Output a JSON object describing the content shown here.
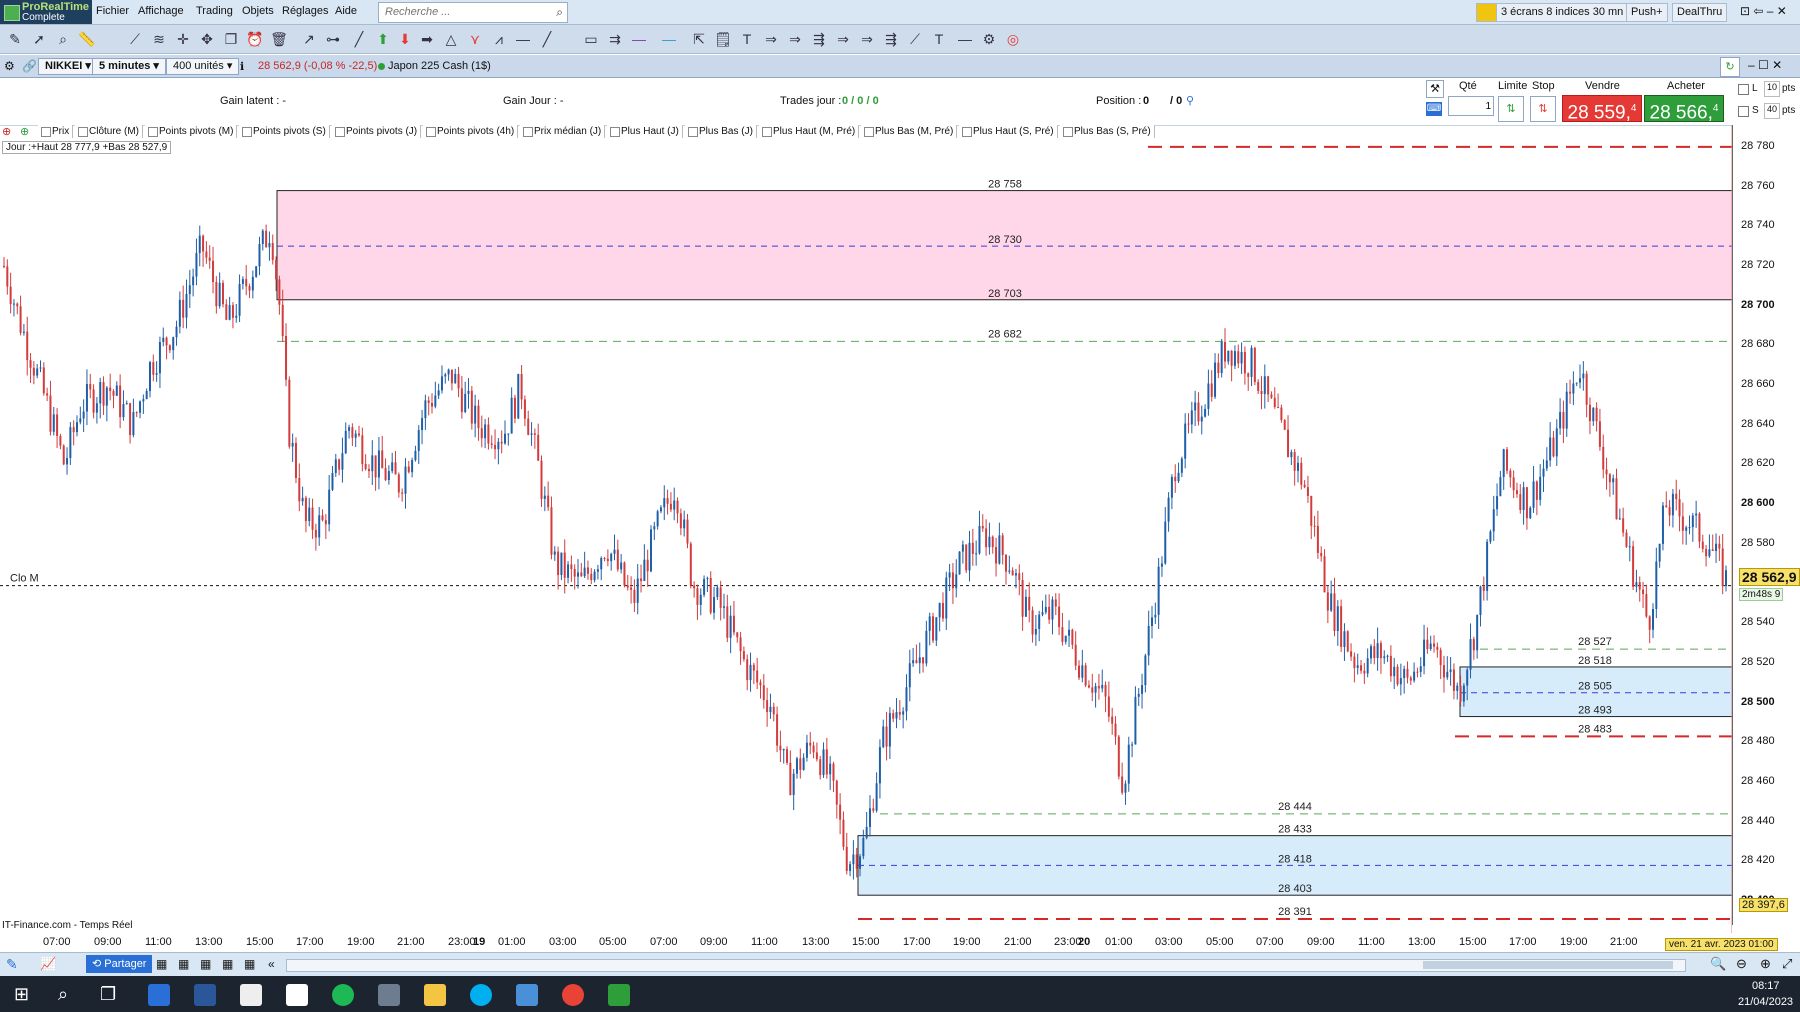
{
  "app": {
    "name_line1": "ProRealTime",
    "name_line2": "Complete"
  },
  "menu": [
    "Fichier",
    "Affichage",
    "Trading",
    "Objets",
    "Réglages",
    "Aide"
  ],
  "search": {
    "placeholder": "Recherche ..."
  },
  "top_right": {
    "layout": "3 écrans 8 indices 30 mn",
    "push": "Push+",
    "dealthru": "DealThru"
  },
  "chart_header": {
    "instrument": "NIKKEI",
    "timeframe": "5 minutes",
    "units": "400 unités",
    "quote": "28 562,9 (-0,08 % -22,5)",
    "market": "Japon 225 Cash (1$)"
  },
  "trading": {
    "gain_latent": "Gain latent : -",
    "gain_jour": "Gain Jour : -",
    "trades_jour_label": "Trades jour :",
    "trades_jour_value": "0 / 0 / 0",
    "position_label": "Position :",
    "position_value": "0",
    "position_extra": "/ 0",
    "qte_label": "Qté",
    "qte_value": "1",
    "limite_label": "Limite",
    "stop_label": "Stop",
    "vendre_label": "Vendre",
    "acheter_label": "Acheter",
    "sell_price": "28 559,",
    "sell_price_sup": "4",
    "buy_price": "28 566,",
    "buy_price_sup": "4",
    "l_label": "L",
    "l_value": "10",
    "s_label": "S",
    "s_value": "40",
    "pts": "pts"
  },
  "indicators": [
    "Prix",
    "Clôture (M)",
    "Points pivots (M)",
    "Points pivots (S)",
    "Points pivots (J)",
    "Points pivots (4h)",
    "Prix médian (J)",
    "Plus Haut (J)",
    "Plus Bas (J)",
    "Plus Haut (M, Pré)",
    "Plus Bas (M, Pré)",
    "Plus Haut (S, Pré)",
    "Plus Bas (S, Pré)"
  ],
  "day_info": "Jour :+Haut 28 777,9 +Bas 28 527,9",
  "clo_label": "Clo M",
  "source": "IT-Finance.com - Temps Réel",
  "price_axis": {
    "ticks": [
      "28 780",
      "28 760",
      "28 740",
      "28 720",
      "28 700",
      "28 680",
      "28 660",
      "28 640",
      "28 620",
      "28 600",
      "28 580",
      "28 560",
      "28 540",
      "28 520",
      "28 500",
      "28 480",
      "28 460",
      "28 440",
      "28 420",
      "28 400"
    ],
    "last_price": "28 562,9",
    "countdown": "2m48s",
    "countdown_val": "9",
    "low_price": "28 397,6"
  },
  "chart_data": {
    "type": "candlestick",
    "ylim": [
      28390,
      28785
    ],
    "zones": [
      {
        "top": 28758,
        "mid": 28730,
        "bottom": 28703,
        "color": "#ffd7e8",
        "labels": [
          "28 758",
          "28 730",
          "28 703"
        ]
      },
      {
        "top": 28518,
        "mid": 28505,
        "bottom": 28493,
        "color": "#d6ecfb",
        "labels": [
          "28 518",
          "28 505",
          "28 493"
        ]
      },
      {
        "top": 28433,
        "mid": 28418,
        "bottom": 28403,
        "color": "#d6ecfb",
        "labels": [
          "28 433",
          "28 418",
          "28 403"
        ]
      }
    ],
    "levels": [
      {
        "value": 28682,
        "label": "28 682",
        "style": "green-dash"
      },
      {
        "value": 28527,
        "label": "28 527",
        "style": "green-dash"
      },
      {
        "value": 28444,
        "label": "28 444",
        "style": "green-dash"
      },
      {
        "value": 28483,
        "label": "28 483",
        "style": "red-dash"
      },
      {
        "value": 28391,
        "label": "28 391",
        "style": "red-dash"
      },
      {
        "value": 28780,
        "label": "",
        "style": "red-dash"
      }
    ],
    "close_m": 28559,
    "x_labels": [
      "07:00",
      "09:00",
      "11:00",
      "13:00",
      "15:00",
      "17:00",
      "19:00",
      "21:00",
      "23:00",
      "19",
      "01:00",
      "03:00",
      "05:00",
      "07:00",
      "09:00",
      "11:00",
      "13:00",
      "15:00",
      "17:00",
      "19:00",
      "21:00",
      "23:00",
      "20",
      "01:00",
      "03:00",
      "05:00",
      "07:00",
      "09:00",
      "11:00",
      "13:00",
      "15:00",
      "17:00",
      "19:00",
      "21:00"
    ],
    "date_flag": "ven. 21 avr. 2023 01:00",
    "price_path": [
      [
        0,
        28720
      ],
      [
        0.01,
        28690
      ],
      [
        0.025,
        28650
      ],
      [
        0.035,
        28620
      ],
      [
        0.045,
        28650
      ],
      [
        0.06,
        28660
      ],
      [
        0.075,
        28640
      ],
      [
        0.085,
        28670
      ],
      [
        0.1,
        28690
      ],
      [
        0.115,
        28730
      ],
      [
        0.13,
        28690
      ],
      [
        0.145,
        28720
      ],
      [
        0.155,
        28740
      ],
      [
        0.16,
        28700
      ],
      [
        0.165,
        28640
      ],
      [
        0.175,
        28590
      ],
      [
        0.185,
        28590
      ],
      [
        0.2,
        28640
      ],
      [
        0.215,
        28620
      ],
      [
        0.23,
        28610
      ],
      [
        0.245,
        28650
      ],
      [
        0.26,
        28665
      ],
      [
        0.275,
        28640
      ],
      [
        0.29,
        28635
      ],
      [
        0.3,
        28660
      ],
      [
        0.31,
        28620
      ],
      [
        0.32,
        28570
      ],
      [
        0.335,
        28560
      ],
      [
        0.35,
        28580
      ],
      [
        0.365,
        28550
      ],
      [
        0.38,
        28590
      ],
      [
        0.39,
        28610
      ],
      [
        0.4,
        28560
      ],
      [
        0.415,
        28550
      ],
      [
        0.43,
        28520
      ],
      [
        0.445,
        28500
      ],
      [
        0.455,
        28460
      ],
      [
        0.47,
        28480
      ],
      [
        0.48,
        28460
      ],
      [
        0.49,
        28420
      ],
      [
        0.5,
        28430
      ],
      [
        0.51,
        28480
      ],
      [
        0.525,
        28510
      ],
      [
        0.54,
        28540
      ],
      [
        0.555,
        28570
      ],
      [
        0.57,
        28585
      ],
      [
        0.585,
        28570
      ],
      [
        0.595,
        28540
      ],
      [
        0.61,
        28545
      ],
      [
        0.625,
        28520
      ],
      [
        0.64,
        28500
      ],
      [
        0.65,
        28460
      ],
      [
        0.66,
        28510
      ],
      [
        0.67,
        28560
      ],
      [
        0.68,
        28620
      ],
      [
        0.695,
        28650
      ],
      [
        0.71,
        28680
      ],
      [
        0.725,
        28670
      ],
      [
        0.74,
        28640
      ],
      [
        0.755,
        28610
      ],
      [
        0.77,
        28550
      ],
      [
        0.785,
        28520
      ],
      [
        0.8,
        28525
      ],
      [
        0.815,
        28510
      ],
      [
        0.83,
        28530
      ],
      [
        0.845,
        28505
      ],
      [
        0.855,
        28540
      ],
      [
        0.87,
        28620
      ],
      [
        0.885,
        28600
      ],
      [
        0.9,
        28630
      ],
      [
        0.915,
        28670
      ],
      [
        0.93,
        28620
      ],
      [
        0.945,
        28570
      ],
      [
        0.955,
        28540
      ],
      [
        0.965,
        28600
      ],
      [
        0.98,
        28590
      ],
      [
        0.99,
        28580
      ],
      [
        1,
        28562
      ]
    ]
  },
  "taskbar": {
    "time": "08:17",
    "date": "21/04/2023"
  },
  "bottom": {
    "share": "Partager"
  }
}
